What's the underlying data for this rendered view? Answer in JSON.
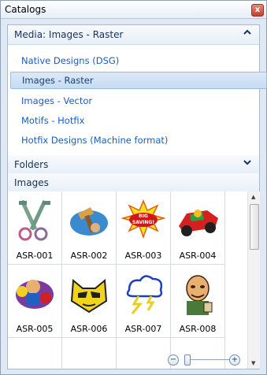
{
  "window": {
    "title": "Catalogs",
    "close_glyph": "x"
  },
  "media_section": {
    "label": "Media: Images - Raster",
    "chevron": "up"
  },
  "media_items": [
    {
      "label": "Native Designs (DSG)",
      "selected": false
    },
    {
      "label": "Images - Raster",
      "selected": true
    },
    {
      "label": "Images - Vector",
      "selected": false
    },
    {
      "label": "Motifs - Hotfix",
      "selected": false
    },
    {
      "label": "Hotfix Designs (Machine format)",
      "selected": false
    }
  ],
  "folders_section": {
    "label": "Folders",
    "chevron": "down"
  },
  "images_section": {
    "label": "Images"
  },
  "thumbnails": [
    {
      "caption": "ASR-001",
      "icon": "keys-icon"
    },
    {
      "caption": "ASR-002",
      "icon": "hammer-icon"
    },
    {
      "caption": "ASR-003",
      "icon": "big-saving-burst-icon"
    },
    {
      "caption": "ASR-004",
      "icon": "race-car-icon"
    },
    {
      "caption": "ASR-005",
      "icon": "boxer-icon"
    },
    {
      "caption": "ASR-006",
      "icon": "cat-face-icon"
    },
    {
      "caption": "ASR-007",
      "icon": "storm-cloud-icon"
    },
    {
      "caption": "ASR-008",
      "icon": "man-with-mug-icon"
    }
  ],
  "burst_text": {
    "line1": "BIG",
    "line2": "SAVING!"
  },
  "zoom": {
    "minus": "−",
    "plus": "+",
    "level": 0.05
  },
  "colors": {
    "accent": "#1a5dbe",
    "selected_bg": "#c6dcf2",
    "header_text": "#15325a"
  }
}
